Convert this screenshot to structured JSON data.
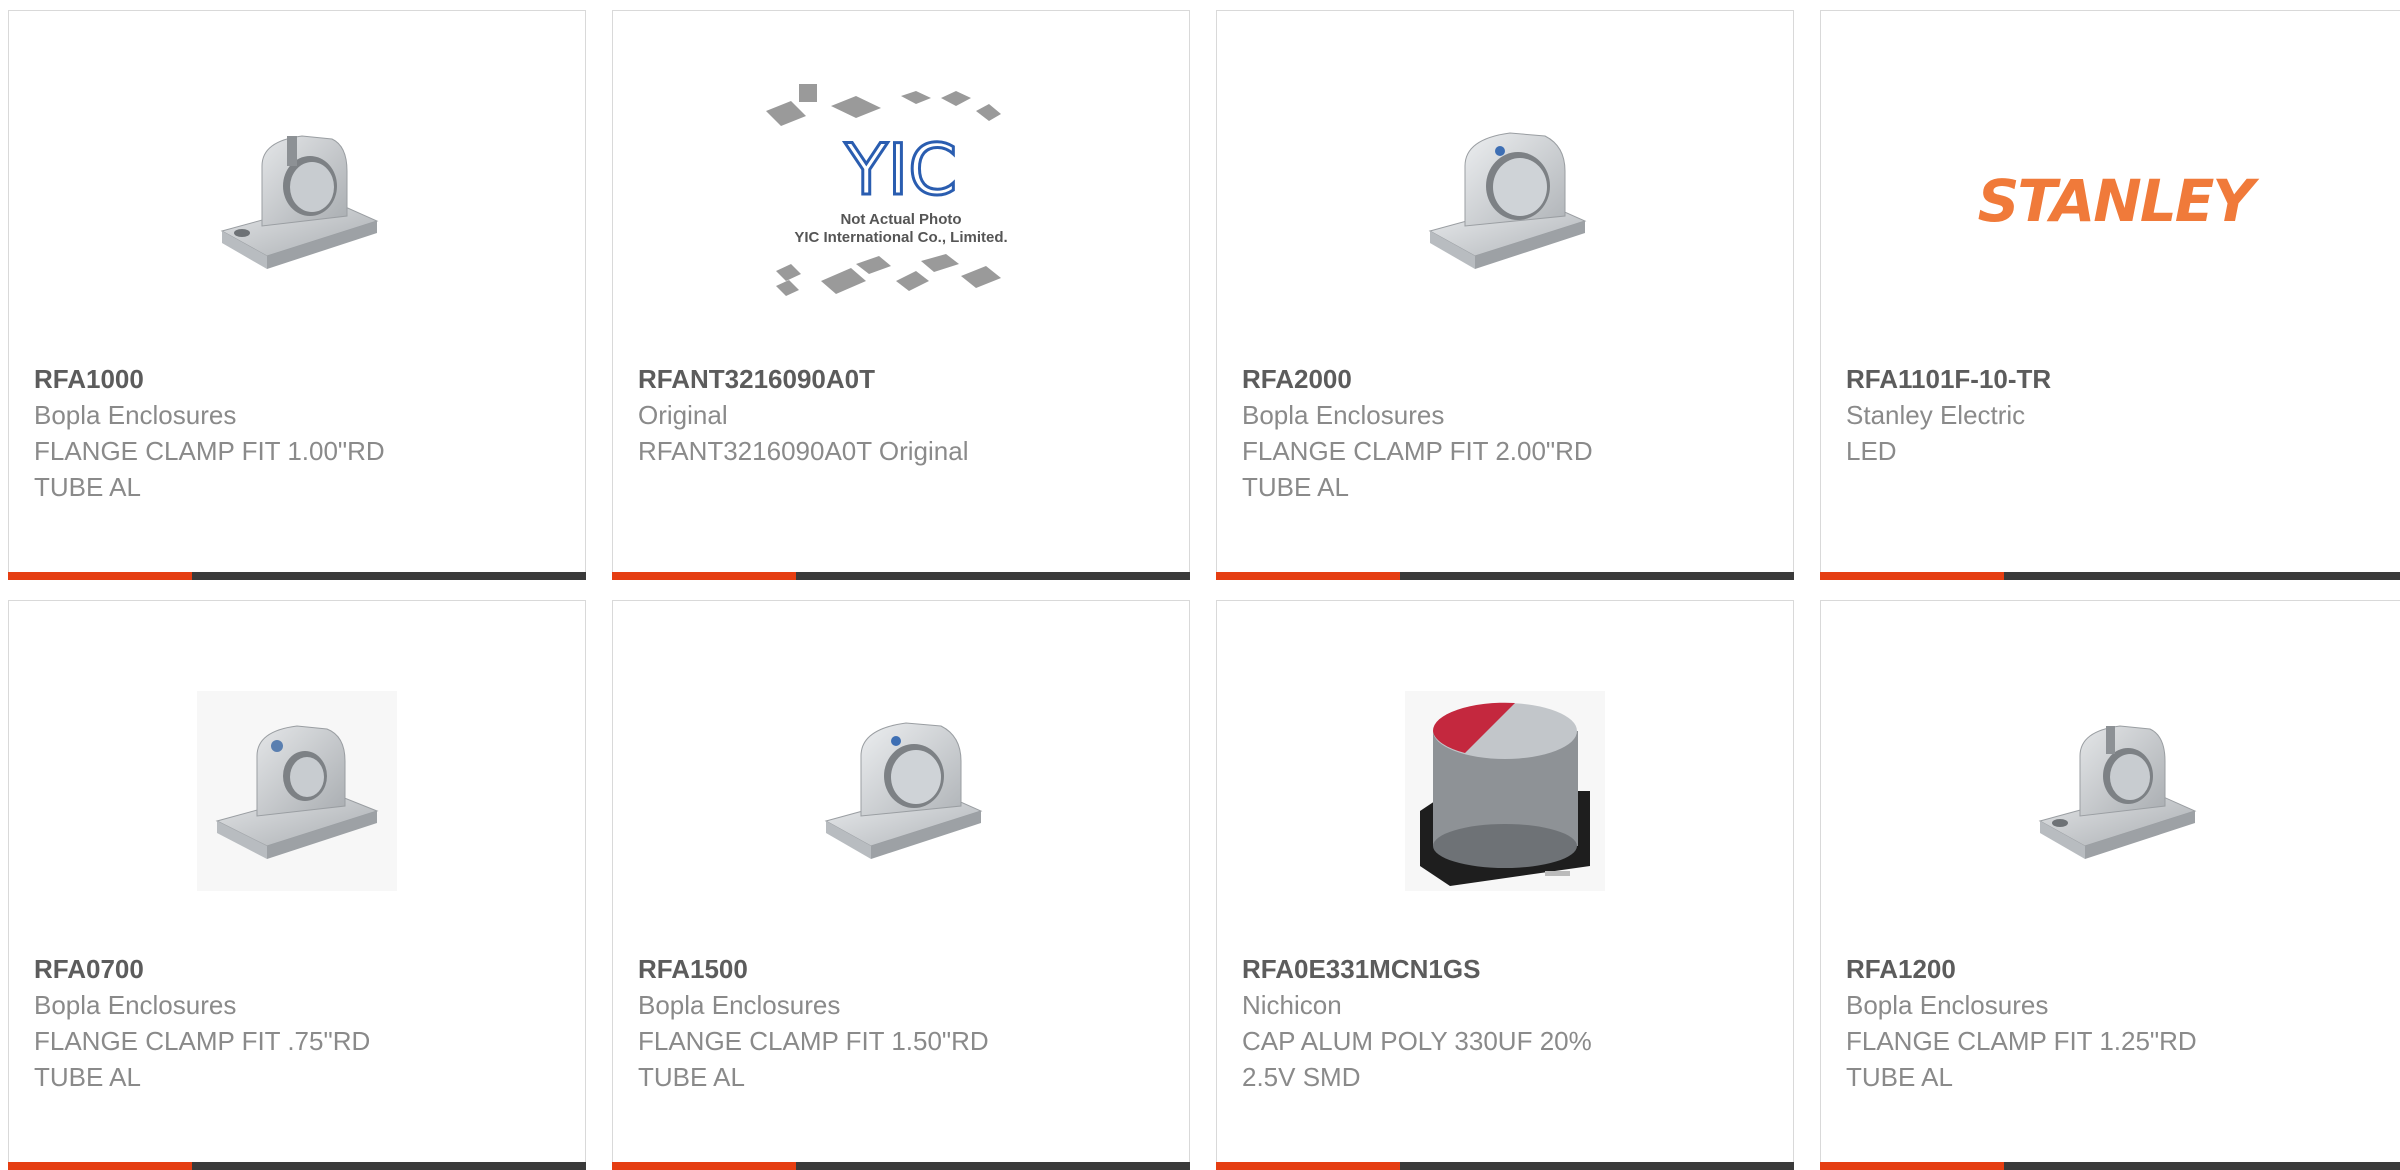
{
  "colors": {
    "accent": "#e53e12",
    "bar": "#3a3a3a",
    "part_number": "#5c5c5c",
    "text": "#8a8a8a"
  },
  "products": [
    {
      "part_number": "RFA1000",
      "manufacturer": "Bopla Enclosures",
      "desc1": "FLANGE CLAMP FIT 1.00\"RD",
      "desc2": "TUBE AL",
      "image": "flange-clamp"
    },
    {
      "part_number": "RFANT3216090A0T",
      "manufacturer": "Original",
      "desc1": "RFANT3216090A0T Original",
      "desc2": "",
      "image": "yic-placeholder",
      "image_text": {
        "logo": "YIC",
        "line1": "Not Actual Photo",
        "line2": "YIC International Co., Limited."
      }
    },
    {
      "part_number": "RFA2000",
      "manufacturer": "Bopla Enclosures",
      "desc1": "FLANGE CLAMP FIT 2.00\"RD",
      "desc2": "TUBE AL",
      "image": "flange-clamp"
    },
    {
      "part_number": "RFA1101F-10-TR",
      "manufacturer": "Stanley Electric",
      "desc1": "LED",
      "desc2": "",
      "image": "stanley-logo",
      "image_text": {
        "logo": "STANLEY"
      }
    },
    {
      "part_number": "RFA0700",
      "manufacturer": "Bopla Enclosures",
      "desc1": "FLANGE CLAMP FIT .75\"RD",
      "desc2": "TUBE AL",
      "image": "flange-clamp"
    },
    {
      "part_number": "RFA1500",
      "manufacturer": "Bopla Enclosures",
      "desc1": "FLANGE CLAMP FIT 1.50\"RD",
      "desc2": "TUBE AL",
      "image": "flange-clamp"
    },
    {
      "part_number": "RFA0E331MCN1GS",
      "manufacturer": "Nichicon",
      "desc1": "CAP ALUM POLY 330UF 20%",
      "desc2": "2.5V SMD",
      "image": "smd-capacitor"
    },
    {
      "part_number": "RFA1200",
      "manufacturer": "Bopla Enclosures",
      "desc1": "FLANGE CLAMP FIT 1.25\"RD",
      "desc2": "TUBE AL",
      "image": "flange-clamp"
    }
  ]
}
